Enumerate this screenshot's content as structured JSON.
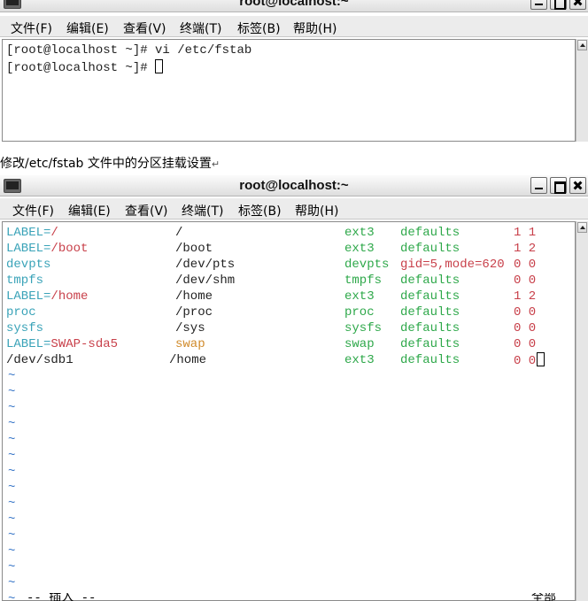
{
  "window1": {
    "title": "root@localhost:~",
    "menu": [
      "文件(F)",
      "编辑(E)",
      "查看(V)",
      "终端(T)",
      "标签(B)",
      "帮助(H)"
    ],
    "lines": [
      "[root@localhost ~]# vi /etc/fstab",
      "[root@localhost ~]# "
    ]
  },
  "caption": {
    "text": "修改/etc/fstab  文件中的分区挂载设置",
    "mark": "↵"
  },
  "window2": {
    "title": "root@localhost:~",
    "menu": [
      "文件(F)",
      "编辑(E)",
      "查看(V)",
      "终端(T)",
      "标签(B)",
      "帮助(H)"
    ],
    "fstab": [
      {
        "device": "LABEL=/",
        "mount": "/",
        "type": "ext3",
        "options": "defaults",
        "dump": "1 1"
      },
      {
        "device": "LABEL=/boot",
        "mount": "/boot",
        "type": "ext3",
        "options": "defaults",
        "dump": "1 2"
      },
      {
        "device": "devpts",
        "mount": "/dev/pts",
        "type": "devpts",
        "options": "gid=5,mode=620",
        "dump": "0 0"
      },
      {
        "device": "tmpfs",
        "mount": "/dev/shm",
        "type": "tmpfs",
        "options": "defaults",
        "dump": "0 0"
      },
      {
        "device": "LABEL=/home",
        "mount": "/home",
        "type": "ext3",
        "options": "defaults",
        "dump": "1 2"
      },
      {
        "device": "proc",
        "mount": "/proc",
        "type": "proc",
        "options": "defaults",
        "dump": "0 0"
      },
      {
        "device": "sysfs",
        "mount": "/sys",
        "type": "sysfs",
        "options": "defaults",
        "dump": "0 0"
      },
      {
        "device": "LABEL=SWAP-sda5",
        "mount": "swap",
        "type": "swap",
        "options": "defaults",
        "dump": "0 0"
      },
      {
        "device": "/dev/sdb1",
        "mount": "/home",
        "type": "ext3",
        "options": "defaults",
        "dump": "0 0"
      }
    ],
    "tilde": "~",
    "status_left": "-- 插入 --",
    "status_right": "全部"
  },
  "colors": {
    "label_prefix": "#3aa3b8",
    "label_value": "#c8404a",
    "plain_device": "#3aa3b8",
    "default_text": "#222222",
    "swap_mount": "#d08a2a",
    "fs_type": "#2ea84a",
    "options": "#2ea84a",
    "options_special": "#c8404a",
    "dump": "#c8404a",
    "tilde": "#3b78c8"
  }
}
